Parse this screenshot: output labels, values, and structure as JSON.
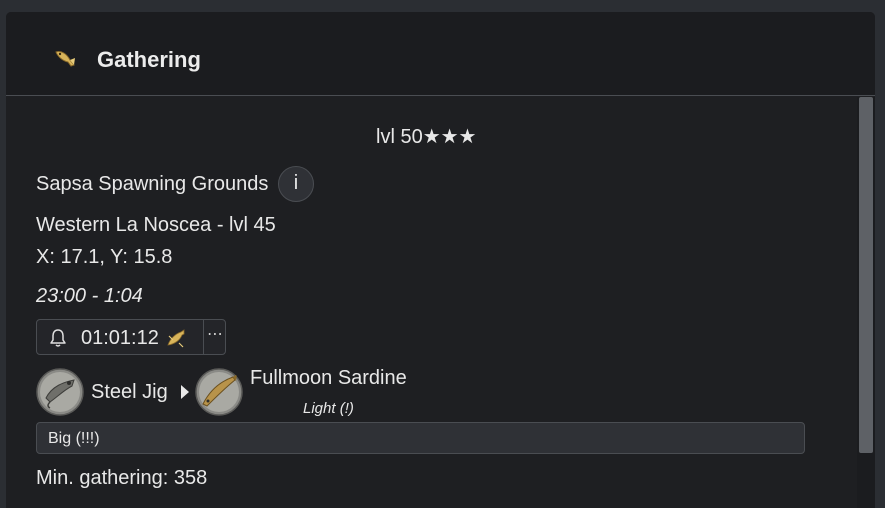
{
  "header": {
    "title": "Gathering",
    "icon": "fish-gathering-icon"
  },
  "level": "lvl 50★★★",
  "spot": {
    "name": "Sapsa Spawning Grounds",
    "info_label": "i",
    "zone": "Western La Noscea - lvl 45",
    "coords": "X: 17.1, Y: 15.8",
    "time_window": "23:00 - 1:04"
  },
  "alarm": {
    "countdown": "01:01:12",
    "more_label": "⋯"
  },
  "bait_chain": {
    "bait": "Steel Jig",
    "fish": "Fullmoon Sardine",
    "tug": "Light (!)"
  },
  "hookset": "Big (!!!)",
  "min_gathering": "Min. gathering: 358",
  "colors": {
    "background": "#2b2e33",
    "panel": "#1e1f22",
    "border": "#4a4d52",
    "accent_gold": "#d8b45a"
  }
}
